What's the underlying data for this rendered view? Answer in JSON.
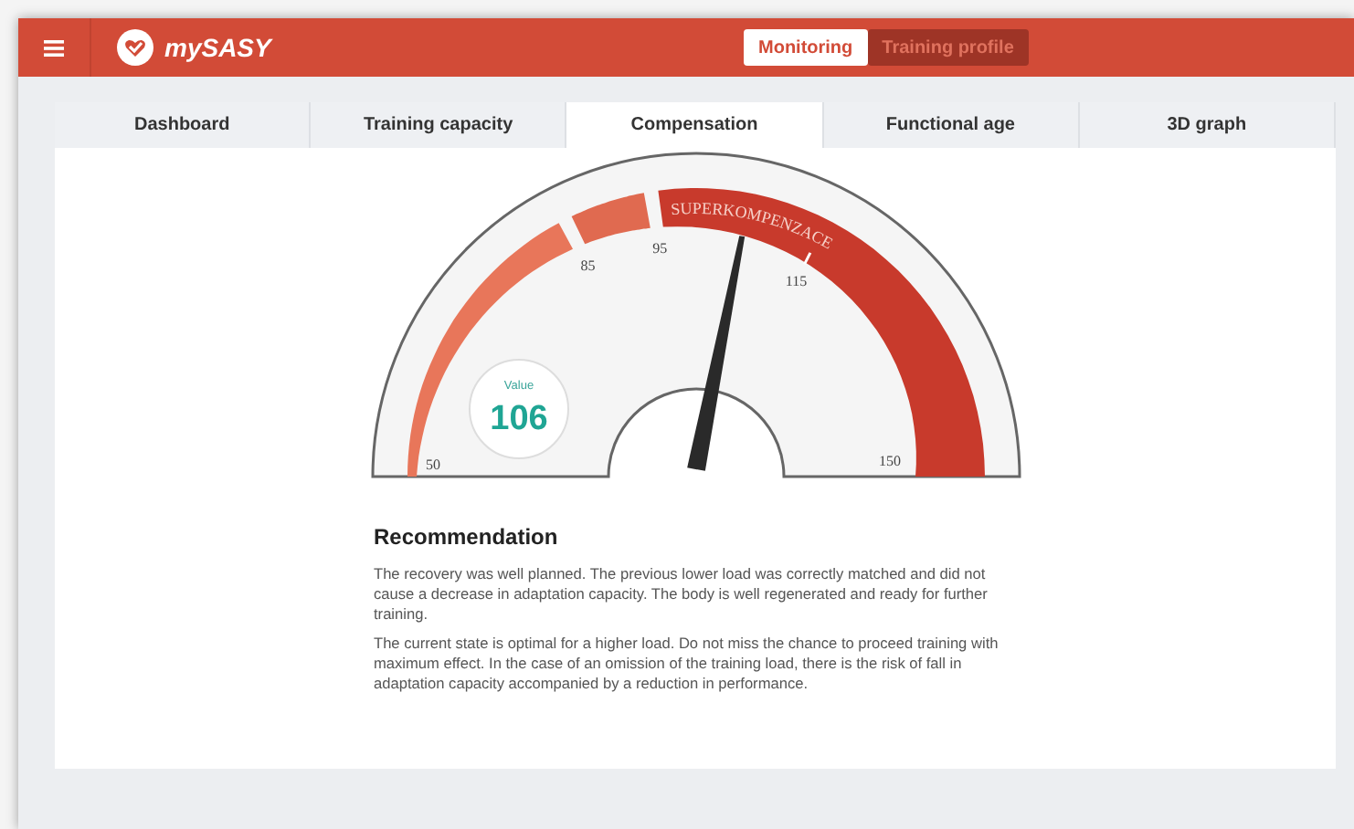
{
  "header": {
    "app_name": "mySASY",
    "modes": [
      {
        "label": "Monitoring",
        "selected": true
      },
      {
        "label": "Training profile",
        "selected": false
      }
    ]
  },
  "tabs": [
    {
      "label": "Dashboard",
      "selected": false
    },
    {
      "label": "Training capacity",
      "selected": false
    },
    {
      "label": "Compensation",
      "selected": true
    },
    {
      "label": "Functional age",
      "selected": false
    },
    {
      "label": "3D graph",
      "selected": false
    }
  ],
  "gauge": {
    "ticks": [
      "50",
      "85",
      "95",
      "115",
      "150"
    ],
    "value_label": "Value",
    "value": "106",
    "segments": [
      {
        "color": "#e8765a"
      },
      {
        "color": "#e06a50"
      },
      {
        "color": "#c83a2c",
        "label": "SUPERKOMPENZACE"
      }
    ]
  },
  "recommendation": {
    "title": "Recommendation",
    "paragraphs": [
      "The recovery was well planned. The previous lower load was correctly matched and did not cause a decrease in adaptation capacity. The body is well regenerated and ready for further training.",
      "The current state is optimal for a higher load. Do not miss the chance to proceed training with maximum effect. In the case of an omission of the training load, there is the risk of fall in adaptation capacity accompanied by a reduction in performance."
    ]
  }
}
